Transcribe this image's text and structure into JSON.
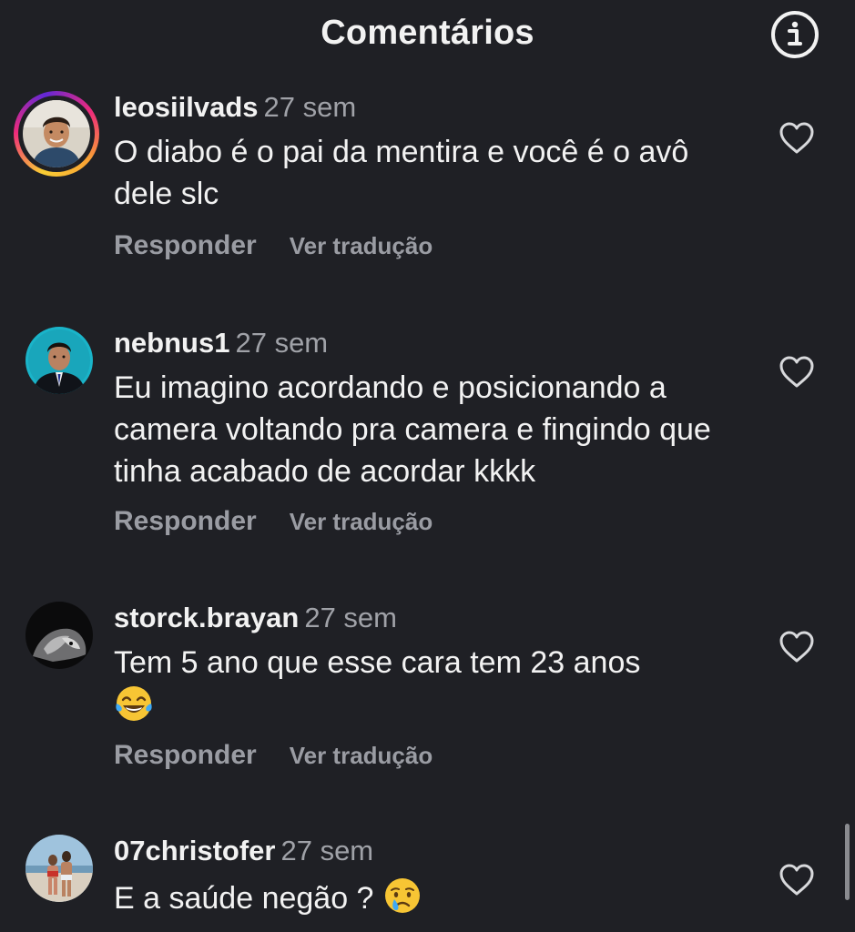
{
  "header": {
    "title": "Comentários",
    "info_icon": "info-circle-icon"
  },
  "comments": [
    {
      "username": "leosiilvads",
      "time": "27 sem",
      "text": "O diabo é o pai da mentira e você é o avô dele slc",
      "reply_label": "Responder",
      "translate_label": "Ver tradução",
      "has_story_ring": true
    },
    {
      "username": "nebnus1",
      "time": "27 sem",
      "text": "Eu imagino acordando e posicionando a camera voltando pra camera e fingindo que tinha acabado de acordar kkkk",
      "reply_label": "Responder",
      "translate_label": "Ver tradução",
      "has_story_ring": false
    },
    {
      "username": "storck.brayan",
      "time": "27 sem",
      "text": "Tem 5 ano que esse cara tem 23 anos",
      "emoji": "tears-of-joy-emoji",
      "reply_label": "Responder",
      "translate_label": "Ver tradução",
      "has_story_ring": false
    },
    {
      "username": "07christofer",
      "time": "27 sem",
      "text": "E a saúde negão ?",
      "emoji": "crying-face-emoji",
      "has_story_ring": false
    }
  ],
  "colors": {
    "background": "#1f2025",
    "secondary_text": "#9a9ca3",
    "primary_text": "#f2f2f2"
  }
}
